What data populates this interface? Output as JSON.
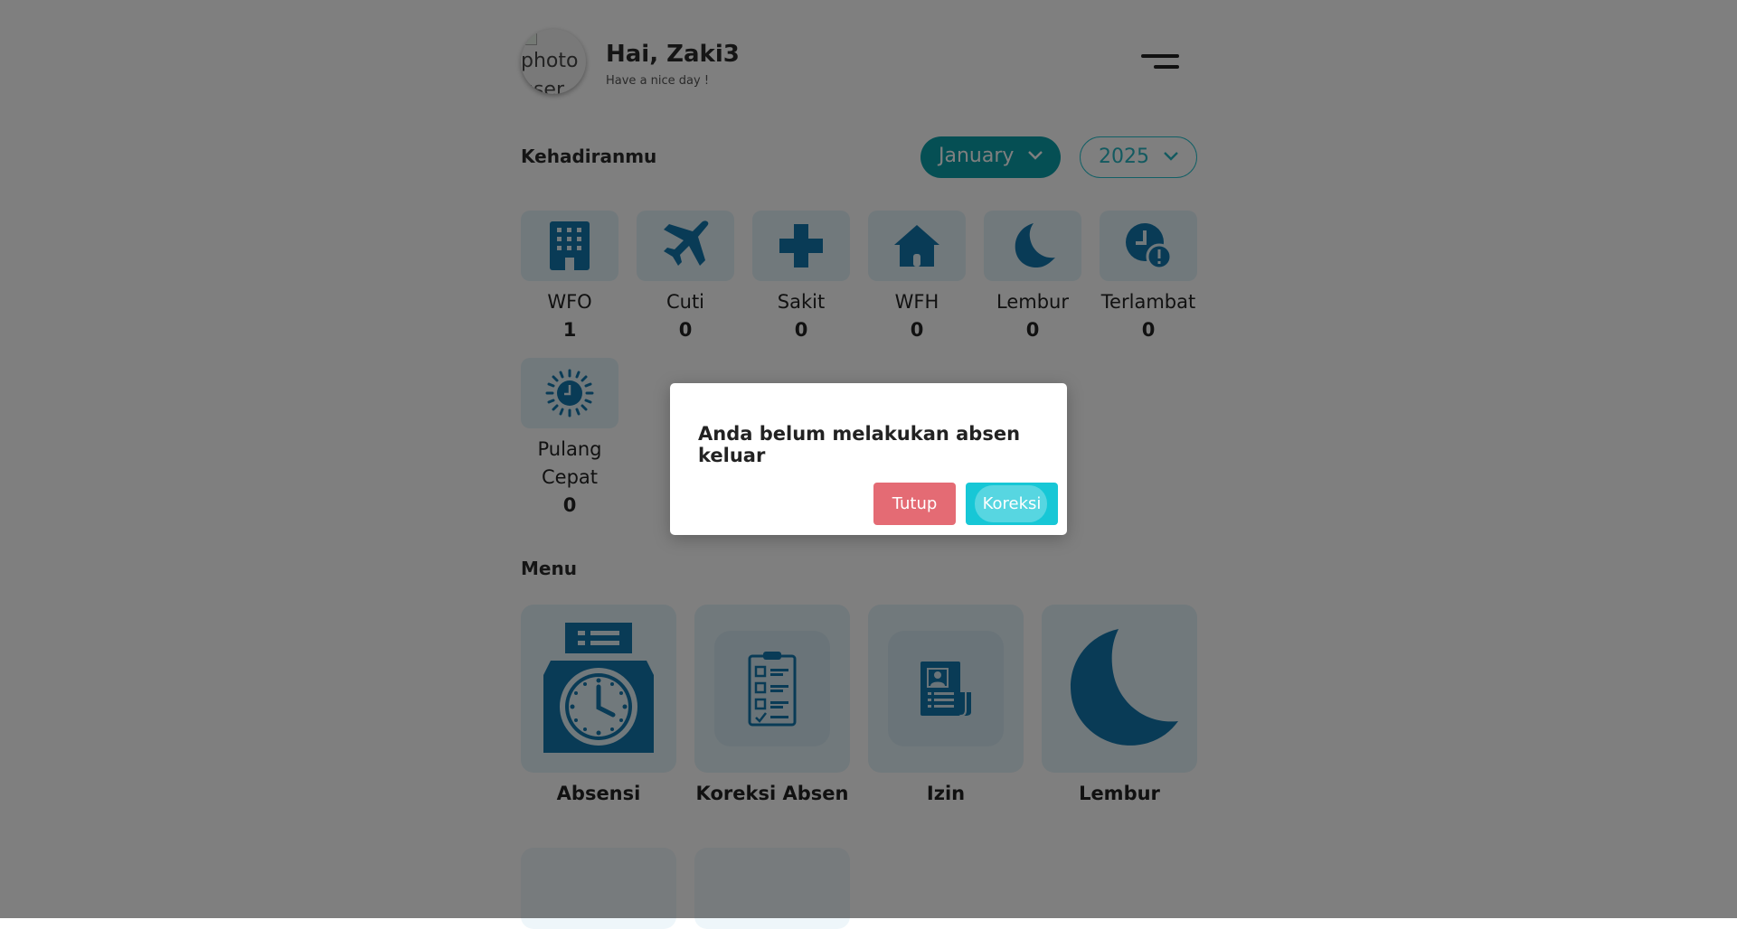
{
  "header": {
    "avatar_alt": "photo user",
    "greeting": "Hai, Zaki3",
    "subtitle": "Have a nice day !"
  },
  "attendance": {
    "title": "Kehadiranmu",
    "month": "January",
    "year": "2025",
    "stats": [
      {
        "label": "WFO",
        "value": "1",
        "icon": "office-building-icon"
      },
      {
        "label": "Cuti",
        "value": "0",
        "icon": "airplane-icon"
      },
      {
        "label": "Sakit",
        "value": "0",
        "icon": "medical-cross-icon"
      },
      {
        "label": "WFH",
        "value": "0",
        "icon": "home-icon"
      },
      {
        "label": "Lembur",
        "value": "0",
        "icon": "moon-icon"
      },
      {
        "label": "Terlambat",
        "value": "0",
        "icon": "clock-alert-icon"
      },
      {
        "label": "Pulang Cepat",
        "value": "0",
        "icon": "sun-clock-icon"
      }
    ]
  },
  "menu": {
    "title": "Menu",
    "items": [
      {
        "label": "Absensi",
        "icon": "time-clock-icon"
      },
      {
        "label": "Koreksi Absen",
        "icon": "clipboard-checklist-icon"
      },
      {
        "label": "Izin",
        "icon": "permit-document-icon"
      },
      {
        "label": "Lembur",
        "icon": "moon-icon"
      }
    ]
  },
  "modal": {
    "message": "Anda belum melakukan absen keluar",
    "close_label": "Tutup",
    "correct_label": "Koreksi"
  },
  "colors": {
    "primary": "#0a9fa8",
    "icon_blue": "#1276ad",
    "tile_bg": "#e3f2f8",
    "danger": "#e46b74",
    "info": "#17c7d6"
  }
}
